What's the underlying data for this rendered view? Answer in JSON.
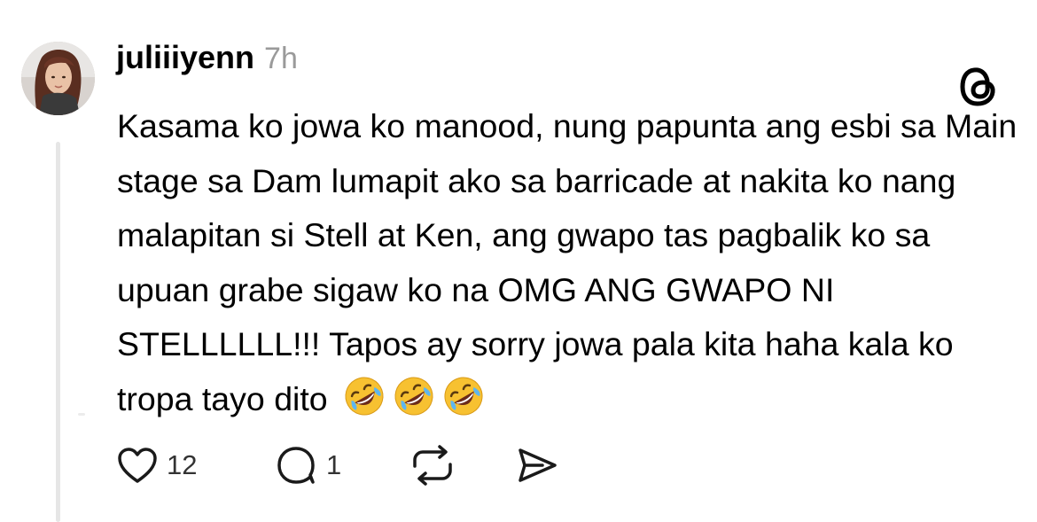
{
  "post": {
    "username": "juliiiyenn",
    "time": "7h",
    "text": "Kasama ko jowa ko manood, nung papunta ang esbi sa Main stage sa Dam lumapit ako sa barricade at nakita ko nang malapitan si Stell at Ken, ang gwapo tas pagbalik ko sa upuan grabe sigaw ko na OMG ANG GWAPO NI STELLLLLL!!! Tapos ay sorry jowa pala kita haha kala ko tropa tayo dito",
    "emojis": [
      "rolling-on-floor-laughing",
      "rolling-on-floor-laughing",
      "rolling-on-floor-laughing"
    ],
    "likes": "12",
    "comments": "1"
  },
  "icons": {
    "avatar": "avatar-photo",
    "brand": "threads-logo-icon",
    "like": "heart-icon",
    "comment": "comment-bubble-icon",
    "repost": "repost-icon",
    "share": "send-icon"
  },
  "colors": {
    "text": "#000000",
    "muted": "#9a9a9a",
    "thread_line": "#e6e6e6",
    "emoji_face": "#f7c131"
  }
}
